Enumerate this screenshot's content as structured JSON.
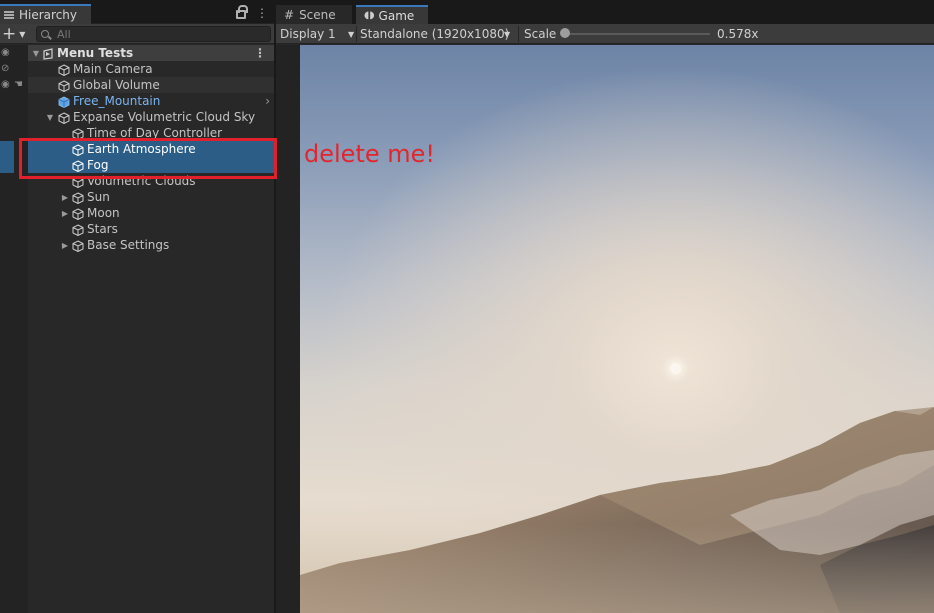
{
  "hierarchy": {
    "tab_label": "Hierarchy",
    "search_placeholder": "All",
    "add_label": "+",
    "rows": [
      {
        "label": "Menu Tests"
      },
      {
        "label": "Main Camera"
      },
      {
        "label": "Global Volume"
      },
      {
        "label": "Free_Mountain"
      },
      {
        "label": "Expanse Volumetric Cloud Sky"
      },
      {
        "label": "Time of Day Controller"
      },
      {
        "label": "Earth Atmosphere"
      },
      {
        "label": "Fog"
      },
      {
        "label": "Volumetric Clouds"
      },
      {
        "label": "Sun"
      },
      {
        "label": "Moon"
      },
      {
        "label": "Stars"
      },
      {
        "label": "Base Settings"
      }
    ]
  },
  "game": {
    "tabs": [
      {
        "label": "Scene"
      },
      {
        "label": "Game"
      }
    ],
    "display": "Display 1",
    "resolution": "Standalone (1920x1080)",
    "scale_label": "Scale",
    "scale_value": "0.578x",
    "scale_fraction": 0.0
  },
  "annotation": {
    "text": "delete me!"
  },
  "colors": {
    "selection": "#2c5d87",
    "prefab_text": "#7ab4f0",
    "annotation_red": "#e0202a",
    "tab_accent": "#3a79bb"
  }
}
